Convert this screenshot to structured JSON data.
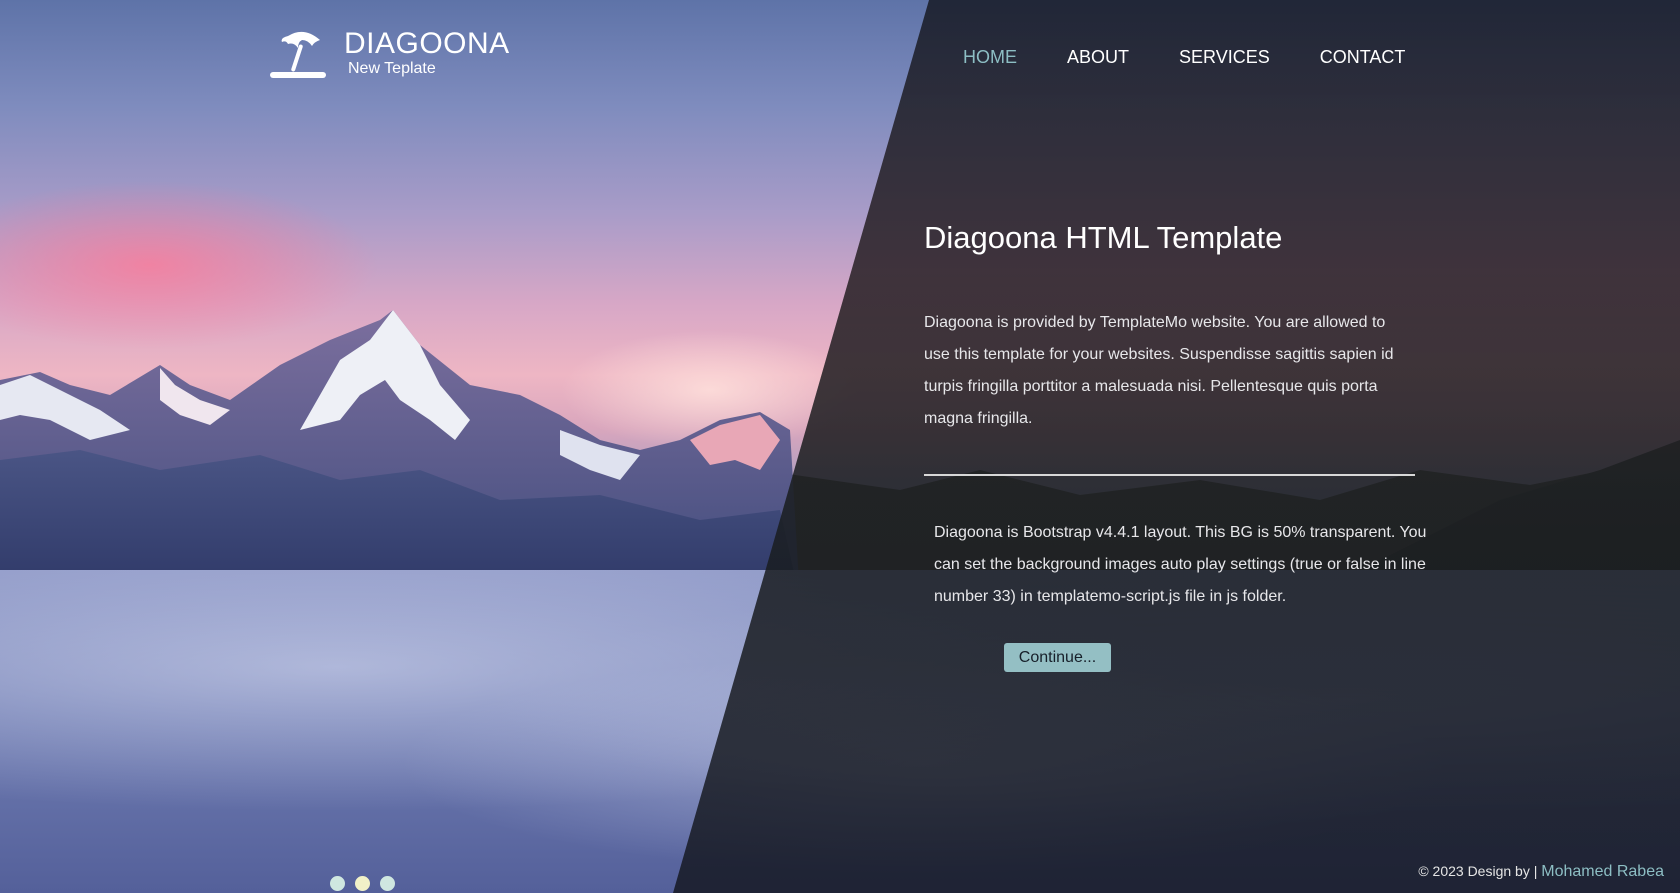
{
  "brand": {
    "title": "DIAGOONA",
    "subtitle": "New Teplate",
    "icon": "beach-umbrella-icon"
  },
  "nav": {
    "items": [
      {
        "label": "HOME",
        "active": true
      },
      {
        "label": "ABOUT",
        "active": false
      },
      {
        "label": "SERVICES",
        "active": false
      },
      {
        "label": "CONTACT",
        "active": false
      }
    ]
  },
  "main": {
    "title": "Diagoona HTML Template",
    "paragraph1": "Diagoona is provided by TemplateMo website. You are allowed to use this template for your websites. Suspendisse sagittis sapien id turpis fringilla porttitor a malesuada nisi. Pellentesque quis porta magna fringilla.",
    "paragraph2": "Diagoona is Bootstrap v4.4.1 layout. This BG is 50% transparent. You can set the background images auto play settings (true or false in line number 33) in templatemo-script.js file in js folder.",
    "continue_label": "Continue..."
  },
  "footer": {
    "copyright": "© 2023 Design by |",
    "author": "Mohamed Rabea"
  },
  "slider": {
    "dot_count": 3,
    "active_index": 1
  },
  "colors": {
    "accent": "#8dbec4",
    "button_bg": "#94bfc4",
    "overlay": "#12141c"
  }
}
